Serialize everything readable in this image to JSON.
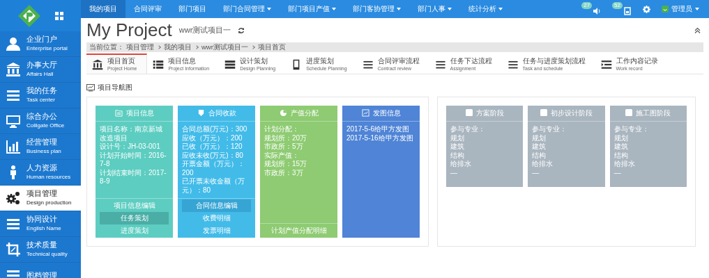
{
  "top_nav": {
    "items": [
      {
        "label": "我的项目",
        "selected": true,
        "dropdown": false
      },
      {
        "label": "合同评审",
        "selected": false,
        "dropdown": false
      },
      {
        "label": "部门项目",
        "selected": false,
        "dropdown": false
      },
      {
        "label": "部门合同管理",
        "selected": false,
        "dropdown": true
      },
      {
        "label": "部门项目产值",
        "selected": false,
        "dropdown": true
      },
      {
        "label": "部门客协管理",
        "selected": false,
        "dropdown": true
      },
      {
        "label": "部门人事",
        "selected": false,
        "dropdown": true
      },
      {
        "label": "统计分析",
        "selected": false,
        "dropdown": true
      }
    ],
    "notifications": [
      {
        "count": "27"
      },
      {
        "count": "52"
      }
    ],
    "user": "管理员"
  },
  "sidebar": {
    "items": [
      {
        "title": "企业门户",
        "subtitle": "Enterprise portal",
        "selected": false
      },
      {
        "title": "办事大厅",
        "subtitle": "Affairs Hall",
        "selected": false
      },
      {
        "title": "我的任务",
        "subtitle": "Task center",
        "selected": false
      },
      {
        "title": "综合办公",
        "subtitle": "Colligate Office",
        "selected": false
      },
      {
        "title": "经营管理",
        "subtitle": "Business plan",
        "selected": false
      },
      {
        "title": "人力资源",
        "subtitle": "Human resources",
        "selected": false
      },
      {
        "title": "项目管理",
        "subtitle": "Design production",
        "selected": true
      },
      {
        "title": "协同设计",
        "subtitle": "English Name",
        "selected": false
      },
      {
        "title": "技术质量",
        "subtitle": "Technical quality",
        "selected": false
      },
      {
        "title": "图档管理",
        "selected": false
      }
    ]
  },
  "page": {
    "title": "My Project",
    "subtitle": "wwr测试项目一",
    "breadcrumb": {
      "label": "当前位置：",
      "items": [
        "项目管理",
        "我的项目",
        "wwr测试项目一",
        "项目首页"
      ]
    },
    "tabs": [
      {
        "title": "项目首页",
        "subtitle": "Project Home",
        "selected": true
      },
      {
        "title": "项目信息",
        "subtitle": "Project Information",
        "selected": false
      },
      {
        "title": "设计策划",
        "subtitle": "Design Planning",
        "selected": false
      },
      {
        "title": "进度策划",
        "subtitle": "Schedule Planning",
        "selected": false
      },
      {
        "title": "合同评审流程",
        "subtitle": "Contract review",
        "selected": false
      },
      {
        "title": "任务下达流程",
        "subtitle": "Assignment",
        "selected": false
      },
      {
        "title": "任务与进度策划流程",
        "subtitle": "Task and schedule",
        "selected": false
      },
      {
        "title": "工作内容记录",
        "subtitle": "Work record",
        "selected": false
      }
    ],
    "section_title": "项目导航图",
    "panels": [
      {
        "cards": [
          {
            "title": "项目信息",
            "color": "#5dcdc1",
            "lines": [
              "项目名称：南京新城改造项目",
              "设计号：JH-03-001",
              "计划开始时间：2016-7-8",
              "计划结束时间：2017-8-9"
            ],
            "links": [
              {
                "label": "项目信息编辑",
                "selected": false
              },
              {
                "label": "任务策划",
                "selected": true
              },
              {
                "label": "进度策划",
                "selected": false
              }
            ]
          },
          {
            "title": "合同收款",
            "color": "#42bbe9",
            "lines": [
              "合同总额(万元)：300",
              "应收（万元）：200",
              "已收（万元）：120",
              "应收未收(万元)：80",
              "开票金额（万元）：200",
              "已开票未收金额（万元）：80"
            ],
            "links": [
              {
                "label": "合同信息编辑",
                "selected": true
              },
              {
                "label": "收费明细",
                "selected": false
              },
              {
                "label": "发票明细",
                "selected": false
              }
            ]
          },
          {
            "title": "产值分配",
            "color": "#8ecb72",
            "lines": [
              "计划分配：",
              "规划所：20万",
              "市政所：5万",
              "实际产值：",
              "规划所：15万",
              "市政所：3万"
            ],
            "links": [
              {
                "label": "计划产值分配明细",
                "selected": false
              }
            ]
          },
          {
            "title": "发图信息",
            "color": "#4f84d6",
            "lines": [
              "2017-5-6给甲方发图",
              "2017-5-16给甲方发图"
            ]
          }
        ]
      },
      {
        "cards": [
          {
            "title": "方案阶段",
            "color": "#a9b5bf",
            "lines": [
              "参与专业：",
              "规划",
              "建筑",
              "结构",
              "给排水",
              "—"
            ]
          },
          {
            "title": "初步设计阶段",
            "color": "#a9b5bf",
            "lines": [
              "参与专业：",
              "规划",
              "建筑",
              "结构",
              "给排水",
              "—"
            ]
          },
          {
            "title": "施工图阶段",
            "color": "#a9b5bf",
            "lines": [
              "参与专业：",
              "规划",
              "建筑",
              "结构",
              "给排水",
              "—"
            ]
          }
        ]
      }
    ]
  }
}
